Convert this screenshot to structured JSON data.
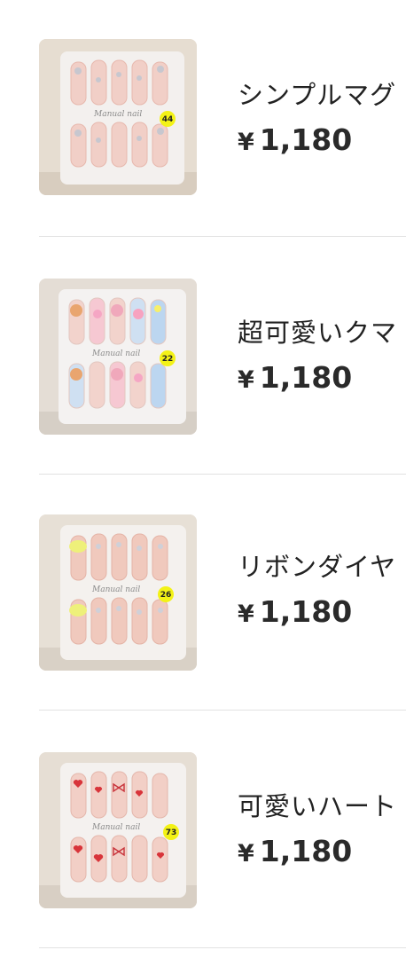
{
  "products": [
    {
      "title": "シンプルマグ",
      "currency": "¥",
      "price": "1,180",
      "badge": "44",
      "brand": "Manual nail",
      "image": "nail-set-clear-with-rhinestones"
    },
    {
      "title": "超可愛いクマ",
      "currency": "¥",
      "price": "1,180",
      "badge": "22",
      "brand": "Manual nail",
      "image": "nail-set-bears-pink-blue"
    },
    {
      "title": "リボンダイヤ",
      "currency": "¥",
      "price": "1,180",
      "badge": "26",
      "brand": "Manual nail",
      "image": "nail-set-yellow-ribbon-diamonds"
    },
    {
      "title": "可愛いハート",
      "currency": "¥",
      "price": "1,180",
      "badge": "73",
      "brand": "Manual nail",
      "image": "nail-set-red-hearts-bows"
    }
  ]
}
